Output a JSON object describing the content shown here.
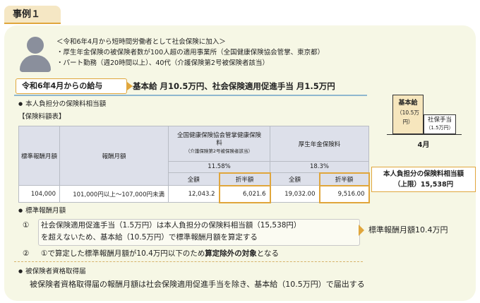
{
  "case_label": "事例１",
  "profile": {
    "lines": [
      "＜令和6年4月から短時間労働者として社会保険に加入＞",
      "・厚生年金保険の被保険者数が100人超の適用事業所（全国健康保険協会管掌、東京都）",
      "・パート勤務（週20時間以上）、40代（介護保険第2号被保険者該当）"
    ]
  },
  "salary": {
    "tag": "令和6年4月からの給与",
    "text": "基本給 月10.5万円、社会保険適用促進手当 月1.5万円"
  },
  "section_premium": "本人負担分の保険料相当額",
  "table_title": "【保険料額表】",
  "table": {
    "col_grade": "標準報酬月額",
    "col_range": "報酬月額",
    "health_title": "全国健康保険協会管掌健康保険料",
    "health_note": "（介護保険第2号被保険者該当）",
    "health_rate": "11.58%",
    "pension_title": "厚生年金保険料",
    "pension_rate": "18.3%",
    "full": "全額",
    "half": "折半額",
    "row": {
      "grade": "104,000",
      "range": "101,000円以上～107,000円未満",
      "health_full": "12,043.2",
      "health_half": "6,021.6",
      "pension_full": "19,032.00",
      "pension_half": "9,516.00"
    }
  },
  "bar_chart": {
    "base_label": "基本給",
    "base_value": "（10.5万円）",
    "allowance_label": "社保手当",
    "allowance_value": "（1.5万円）",
    "month": "4月"
  },
  "limit": {
    "line1": "本人負担分の保険料相当額",
    "line2": "（上限）15,538円"
  },
  "section_grade": "標準報酬月額",
  "step1": {
    "num": "①",
    "line1": "社会保険適用促進手当（1.5万円）は本人負担分の保険料相当額（15,538円）",
    "line2": "を超えないため、基本給（10.5万円）で標準報酬月額を算定する"
  },
  "step1_result": "標準報酬月額10.4万円",
  "step2": {
    "num": "②",
    "pre": "①で算定した標準報酬月額が10.4万円以下のため",
    "bold": "算定除外の対象",
    "post": "となる"
  },
  "section_notice": "被保険者資格取得届",
  "final_text": "被保険者資格取得届の報酬月額は社会保険適用促進手当を除き、基本給（10.5万円）で届出する"
}
